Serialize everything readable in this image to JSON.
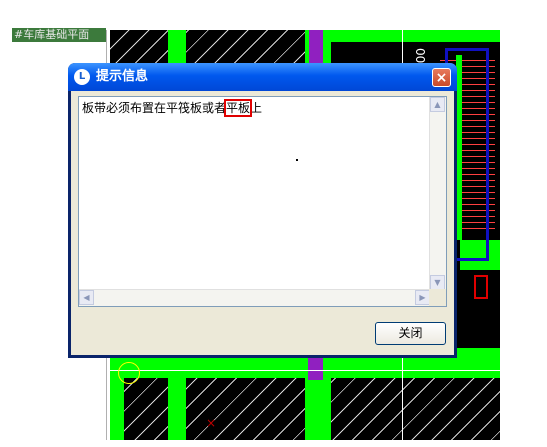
{
  "background_tab": {
    "label": "#车库基础平面"
  },
  "cad_view": {
    "number_label": "00"
  },
  "dialog": {
    "title": "提示信息",
    "app_icon": "app-logo-icon",
    "close_glyph": "×",
    "message": {
      "before": "板带必须布置在平筏板或者",
      "highlight": "平板",
      "after": "上"
    },
    "close_button": "关闭"
  },
  "colors": {
    "cad_background": "#000000",
    "cad_green": "#00ff00",
    "annotation_red": "#e00000",
    "annotation_blue": "#1010c0",
    "title_bar": "#0058ee"
  }
}
